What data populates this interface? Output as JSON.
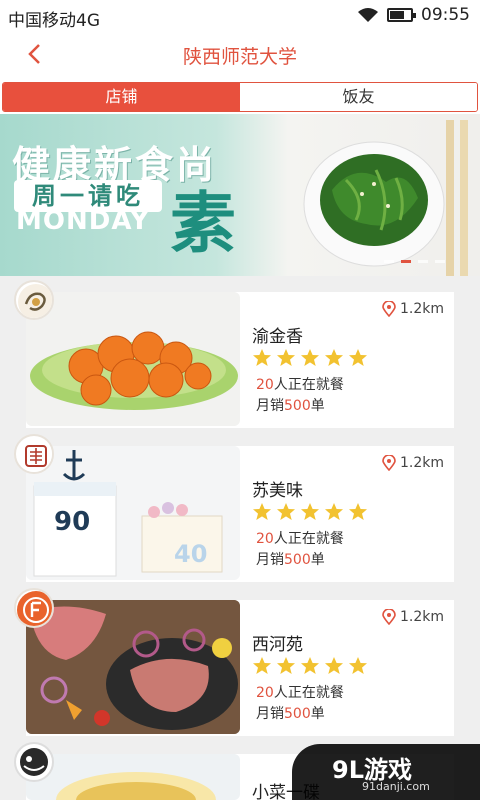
{
  "status": {
    "carrier": "中国移动4G",
    "time": "09:55"
  },
  "header": {
    "title": "陕西师范大学"
  },
  "tabs": [
    {
      "label": "店铺"
    },
    {
      "label": "饭友"
    }
  ],
  "banner": {
    "headline": "健康新食尚",
    "pill": "周一请吃",
    "monday": "MONDAY",
    "big_char": "素",
    "slide_count": 4,
    "active_slide": 2
  },
  "stores": [
    {
      "name": "渝金香",
      "distance": "1.2km",
      "rating": 5,
      "dining_count": "20",
      "dining_suffix": "人正在就餐",
      "sales_prefix": "月销",
      "sales_count": "500",
      "sales_suffix": "单"
    },
    {
      "name": "苏美味",
      "distance": "1.2km",
      "rating": 5,
      "dining_count": "20",
      "dining_suffix": "人正在就餐",
      "sales_prefix": "月销",
      "sales_count": "500",
      "sales_suffix": "单"
    },
    {
      "name": "西河苑",
      "distance": "1.2km",
      "rating": 5,
      "dining_count": "20",
      "dining_suffix": "人正在就餐",
      "sales_prefix": "月销",
      "sales_count": "500",
      "sales_suffix": "单"
    },
    {
      "name": "小菜一碟"
    }
  ],
  "watermark": {
    "main": "9L游戏",
    "sub": "91danji.com"
  },
  "colors": {
    "accent": "#e0533f",
    "star": "#f2c230",
    "banner_teal": "#1e8e7e"
  }
}
